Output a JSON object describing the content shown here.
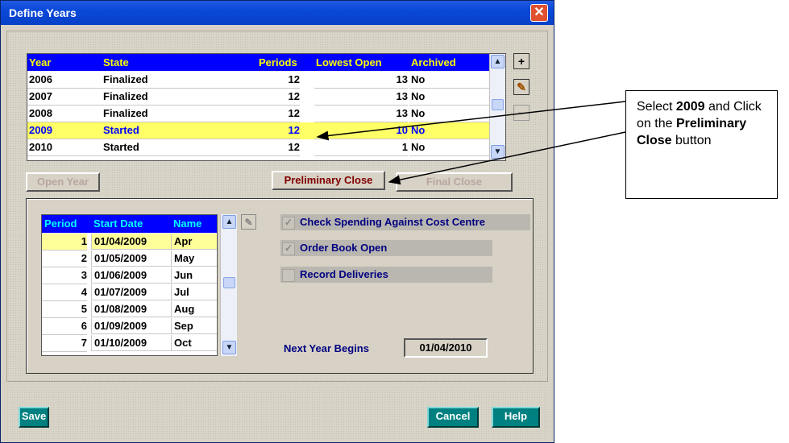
{
  "window": {
    "title": "Define Years",
    "close_glyph": "✕"
  },
  "years_table": {
    "headers": [
      "Year",
      "State",
      "Periods",
      "Lowest Open",
      "Archived"
    ],
    "rows": [
      [
        "2006",
        "Finalized",
        "12",
        "13",
        "No"
      ],
      [
        "2007",
        "Finalized",
        "12",
        "13",
        "No"
      ],
      [
        "2008",
        "Finalized",
        "12",
        "13",
        "No"
      ],
      [
        "2009",
        "Started",
        "12",
        "10",
        "No"
      ],
      [
        "2010",
        "Started",
        "12",
        "1",
        "No"
      ]
    ],
    "selected_index": 3
  },
  "side_tools": {
    "add": "+",
    "edit": "✎",
    "remove": "−"
  },
  "buttons": {
    "open_year": "Open Year",
    "preliminary_close": "Preliminary Close",
    "final_close": "Final Close",
    "save": "Save",
    "cancel": "Cancel",
    "help": "Help"
  },
  "periods_table": {
    "headers": [
      "Period",
      "Start Date",
      "Name"
    ],
    "rows": [
      [
        "1",
        "01/04/2009",
        "Apr"
      ],
      [
        "2",
        "01/05/2009",
        "May"
      ],
      [
        "3",
        "01/06/2009",
        "Jun"
      ],
      [
        "4",
        "01/07/2009",
        "Jul"
      ],
      [
        "5",
        "01/08/2009",
        "Aug"
      ],
      [
        "6",
        "01/09/2009",
        "Sep"
      ],
      [
        "7",
        "01/10/2009",
        "Oct"
      ]
    ],
    "selected_index": 0
  },
  "options": {
    "check_spending": {
      "label": "Check Spending Against Cost Centre",
      "checked": true
    },
    "order_book_open": {
      "label": "Order Book Open",
      "checked": true
    },
    "record_deliveries": {
      "label": "Record Deliveries",
      "checked": false
    }
  },
  "next_year": {
    "label": "Next Year Begins",
    "value": "01/04/2010"
  },
  "callout": {
    "text_before": "Select ",
    "year": "2009",
    "text_middle": " and Click on the ",
    "button_name": "Preliminary Close",
    "text_after": " button"
  },
  "colors": {
    "title_bar": "#0a48d8",
    "grid_header": "#0000ff",
    "selected_row": "#ffff66",
    "teal_button": "#008080"
  }
}
